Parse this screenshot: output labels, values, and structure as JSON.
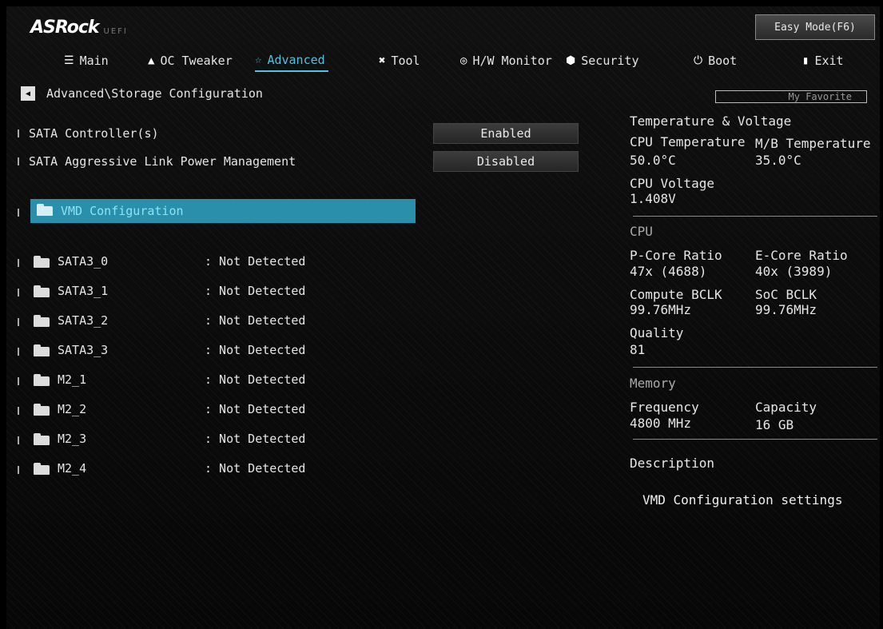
{
  "brand": {
    "name": "ASRock",
    "sub": "UEFI"
  },
  "easy_mode": "Easy Mode(F6)",
  "nav": [
    {
      "label": "Main",
      "icon": "list-icon"
    },
    {
      "label": "OC Tweaker",
      "icon": "rocket-icon"
    },
    {
      "label": "Advanced",
      "icon": "star-icon"
    },
    {
      "label": "Tool",
      "icon": "tools-icon"
    },
    {
      "label": "H/W Monitor",
      "icon": "gauge-icon"
    },
    {
      "label": "Security",
      "icon": "shield-icon"
    },
    {
      "label": "Boot",
      "icon": "power-icon"
    },
    {
      "label": "Exit",
      "icon": "exit-icon"
    }
  ],
  "active_tab": "Advanced",
  "breadcrumb": "Advanced\\Storage Configuration",
  "favorite": "My Favorite",
  "settings": [
    {
      "label": "SATA Controller(s)",
      "value": "Enabled"
    },
    {
      "label": "SATA Aggressive Link Power Management",
      "value": "Disabled"
    }
  ],
  "selected_item": "VMD Configuration",
  "devices": [
    {
      "name": "SATA3_0",
      "status": ": Not Detected"
    },
    {
      "name": "SATA3_1",
      "status": ": Not Detected"
    },
    {
      "name": "SATA3_2",
      "status": ": Not Detected"
    },
    {
      "name": "SATA3_3",
      "status": ": Not Detected"
    },
    {
      "name": "M2_1",
      "status": ": Not Detected"
    },
    {
      "name": "M2_2",
      "status": ": Not Detected"
    },
    {
      "name": "M2_3",
      "status": ": Not Detected"
    },
    {
      "name": "M2_4",
      "status": ": Not Detected"
    }
  ],
  "monitor": {
    "temp_heading": "Temperature & Voltage",
    "cpu_temp_label": "CPU Temperature",
    "cpu_temp": "50.0°C",
    "mb_temp_label": "M/B Temperature",
    "mb_temp": "35.0°C",
    "cpu_volt_label": "CPU Voltage",
    "cpu_volt": "1.408V",
    "cpu_heading": "CPU",
    "pcore_label": "P-Core Ratio",
    "pcore": "47x (4688)",
    "ecore_label": "E-Core Ratio",
    "ecore": "40x (3989)",
    "cbclk_label": "Compute BCLK",
    "cbclk": "99.76MHz",
    "socbclk_label": "SoC BCLK",
    "socbclk": "99.76MHz",
    "quality_label": "Quality",
    "quality": "81",
    "mem_heading": "Memory",
    "freq_label": "Frequency",
    "freq": "4800 MHz",
    "cap_label": "Capacity",
    "cap": "16 GB"
  },
  "description": {
    "heading": "Description",
    "text": "VMD Configuration settings"
  },
  "colors": {
    "accent": "#4fc3e0",
    "selection": "#2a8fab"
  }
}
